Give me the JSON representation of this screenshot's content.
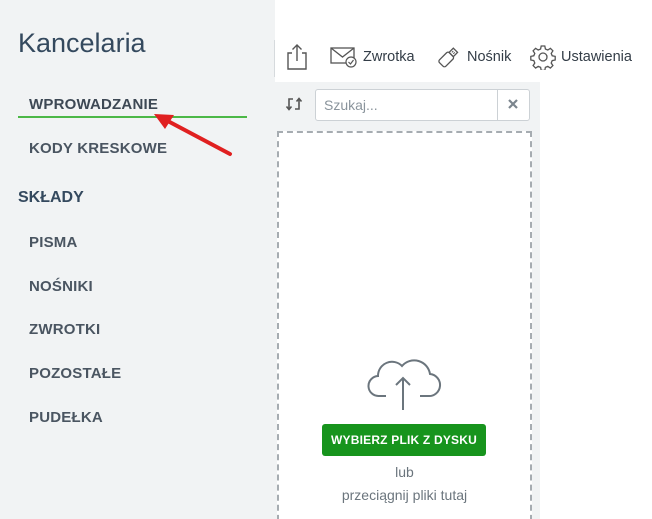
{
  "sidebar": {
    "title": "Kancelaria",
    "items": [
      {
        "label": "WPROWADZANIE"
      },
      {
        "label": "KODY KRESKOWE"
      }
    ],
    "section_title": "SKŁADY",
    "section_items": [
      {
        "label": "PISMA"
      },
      {
        "label": "NOŚNIKI"
      },
      {
        "label": "ZWROTKI"
      },
      {
        "label": "POZOSTAŁE"
      },
      {
        "label": "PUDEŁKA"
      }
    ]
  },
  "toolbar": {
    "export_icon": "share-upload-icon",
    "zwrotka_label": "Zwrotka",
    "nosnik_label": "Nośnik",
    "ustawienia_label": "Ustawienia"
  },
  "search": {
    "placeholder": "Szukaj...",
    "value": ""
  },
  "upload": {
    "button_label": "WYBIERZ PLIK Z DYSKU",
    "or_text": "lub",
    "drag_text": "przeciągnij pliki tutaj",
    "icon": "cloud-upload-icon"
  },
  "colors": {
    "accent_green": "#17941d",
    "active_underline": "#4cb847",
    "annotation_arrow": "#e02020",
    "sidebar_bg": "#f1f3f4"
  }
}
